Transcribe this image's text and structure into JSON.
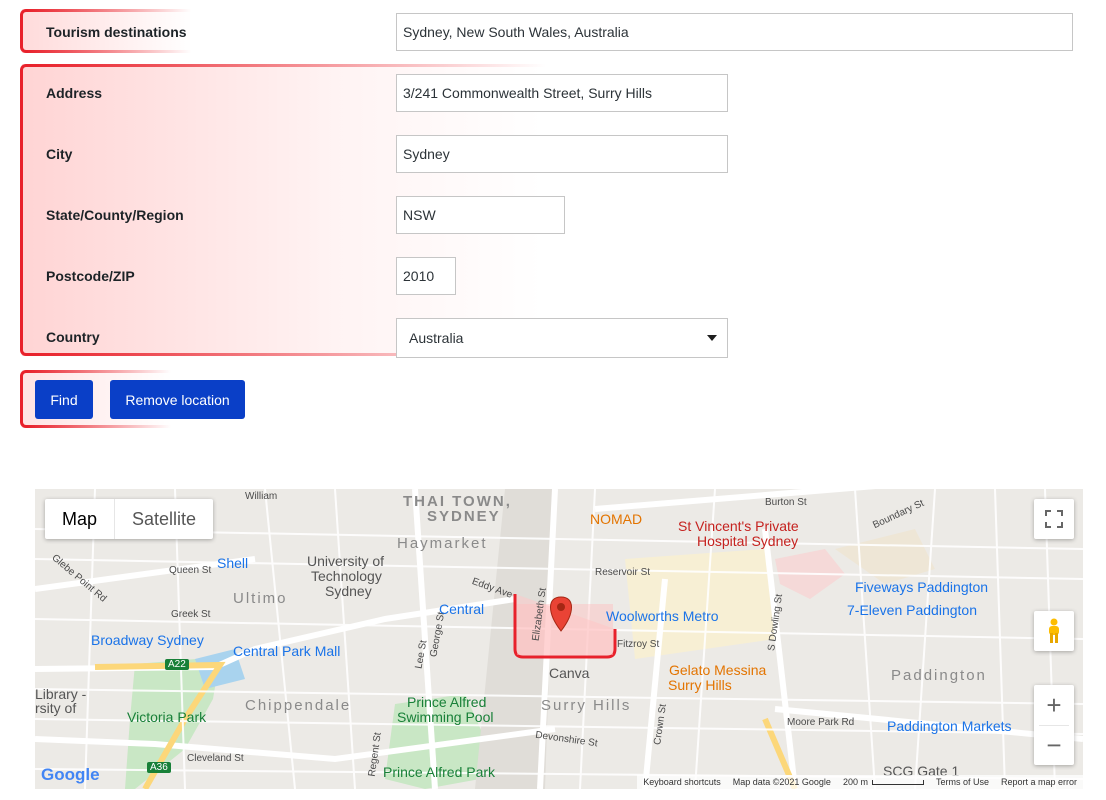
{
  "form": {
    "tourism": {
      "label": "Tourism destinations",
      "value": "Sydney, New South Wales, Australia"
    },
    "address": {
      "label": "Address",
      "value": "3/241 Commonwealth Street, Surry Hills"
    },
    "city": {
      "label": "City",
      "value": "Sydney"
    },
    "state": {
      "label": "State/County/Region",
      "value": "NSW"
    },
    "postcode": {
      "label": "Postcode/ZIP",
      "value": "2010"
    },
    "country": {
      "label": "Country",
      "value": "Australia"
    }
  },
  "buttons": {
    "find": "Find",
    "remove": "Remove location"
  },
  "map": {
    "type_map": "Map",
    "type_satellite": "Satellite",
    "areas": [
      "THAI TOWN,",
      "SYDNEY",
      "Haymarket",
      "Ultimo",
      "Chippendale",
      "Surry Hills",
      "Paddington"
    ],
    "pois": {
      "nomad": "NOMAD",
      "st_vincents": "St Vincent's Private",
      "st_vincents_2": "Hospital Sydney",
      "shell": "Shell",
      "uts_1": "University of",
      "uts_2": "Technology",
      "uts_3": "Sydney",
      "central": "Central",
      "woolworths": "Woolworths Metro",
      "fiveways": "Fiveways Paddington",
      "seven_eleven": "7-Eleven Paddington",
      "broadway": "Broadway Sydney",
      "central_park": "Central Park Mall",
      "canva": "Canva",
      "gelato_1": "Gelato Messina",
      "gelato_2": "Surry Hills",
      "prince_pool_1": "Prince Alfred",
      "prince_pool_2": "Swimming Pool",
      "victoria_park": "Victoria Park",
      "prince_park": "Prince Alfred Park",
      "paddington_markets": "Paddington Markets",
      "library_1": "Library -",
      "library_2": "rsity of",
      "scg": "SCG Gate 1"
    },
    "streets": {
      "burton": "Burton St",
      "william": "William",
      "elizabeth": "Elizabeth St",
      "george": "George St",
      "lee": "Lee St",
      "regent": "Regent St",
      "crown": "Crown St",
      "dowling": "S Dowling St",
      "moore_park": "Moore Park Rd",
      "cleveland": "Cleveland St",
      "devonshire": "Devonshire St",
      "fitzroy": "Fitzroy St",
      "reservoir": "Reservoir St",
      "eddy": "Eddy Ave",
      "glebe_point": "Glebe Point Rd",
      "greek": "Greek St",
      "queen": "Queen St",
      "boundary": "Boundary St",
      "a22": "A22",
      "a36": "A36"
    },
    "footer": {
      "shortcuts": "Keyboard shortcuts",
      "data": "Map data ©2021 Google",
      "scale": "200 m",
      "terms": "Terms of Use",
      "report": "Report a map error"
    },
    "logo": "Google"
  }
}
